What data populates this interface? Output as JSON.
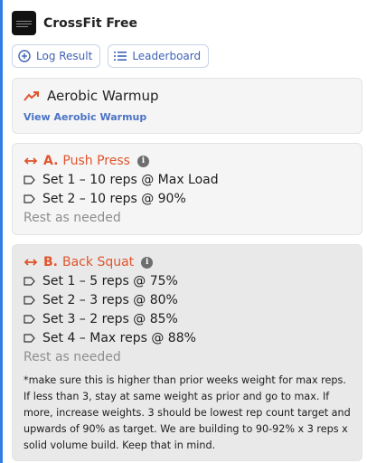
{
  "app": {
    "title": "CrossFit Free"
  },
  "actions": {
    "log_result": "Log Result",
    "leaderboard": "Leaderboard"
  },
  "warmup": {
    "title": "Aerobic Warmup",
    "link": "View Aerobic Warmup"
  },
  "exercises": [
    {
      "letter": "A.",
      "name": "Push Press",
      "sets": [
        "Set 1 – 10 reps @ Max Load",
        "Set 2 – 10 reps @ 90%"
      ],
      "rest": "Rest as needed"
    },
    {
      "letter": "B.",
      "name": "Back Squat",
      "sets": [
        "Set 1 – 5 reps @ 75%",
        "Set 2 – 3 reps @ 80%",
        "Set 3 – 2 reps @ 85%",
        "Set 4 – Max reps @ 88%"
      ],
      "rest": "Rest as needed",
      "note": "*make sure this is higher than prior weeks weight for max reps. If less than 3, stay at same weight as prior and go to max. If more, increase weights. 3 should be lowest rep count target and upwards of 90% as target. We are building to 90-92% x 3 reps x solid volume build. Keep that in mind."
    }
  ],
  "colors": {
    "accent": "#e0552d",
    "link": "#4b73c4",
    "frame_border": "#2f7de6"
  },
  "icons": {
    "log_result": "plus-circle-icon",
    "leaderboard": "list-icon",
    "warmup": "trending-up-icon",
    "exercise": "double-arrow-icon",
    "info": "info-icon",
    "set": "tag-icon"
  }
}
